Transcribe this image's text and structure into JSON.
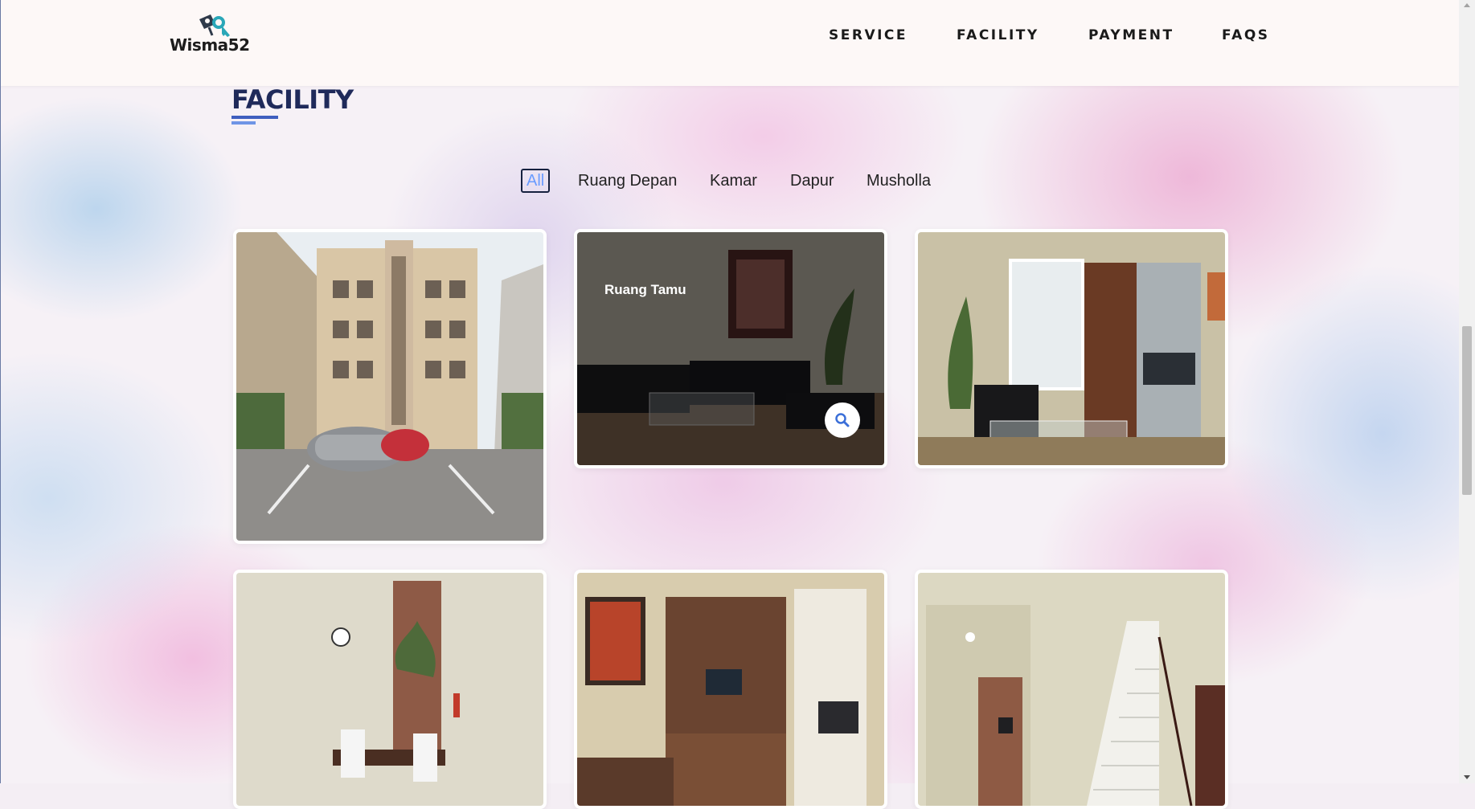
{
  "brand": {
    "name": "Wisma52",
    "logo_icon": "keys-icon"
  },
  "nav": [
    {
      "label": "SERVICE"
    },
    {
      "label": "FACILITY"
    },
    {
      "label": "PAYMENT"
    },
    {
      "label": "FAQS"
    }
  ],
  "section": {
    "title": "FACILITY"
  },
  "filters": [
    {
      "label": "All",
      "active": true
    },
    {
      "label": "Ruang Depan",
      "active": false
    },
    {
      "label": "Kamar",
      "active": false
    },
    {
      "label": "Dapur",
      "active": false
    },
    {
      "label": "Musholla",
      "active": false
    }
  ],
  "gallery": {
    "hover_caption": "Ruang Tamu",
    "zoom_icon": "search-icon"
  },
  "colors": {
    "accent": "#6a9cff",
    "title": "#1f2a5a",
    "header_bg": "#fdf8f7"
  }
}
